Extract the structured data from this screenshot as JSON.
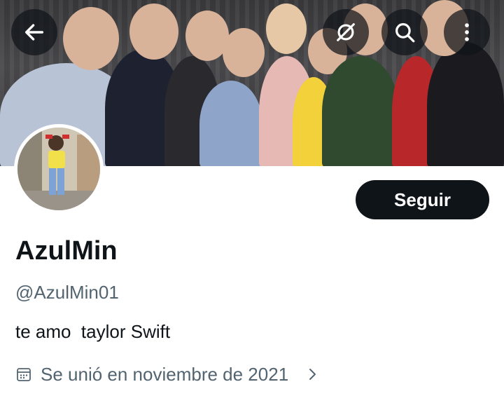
{
  "header": {
    "back_icon": "arrow-left-icon",
    "actions": [
      "sync-off-icon",
      "search-icon",
      "more-vertical-icon"
    ]
  },
  "profile": {
    "display_name": "AzulMin",
    "handle": "@AzulMin01",
    "bio": "te amo  taylor Swift",
    "joined": "Se unió en noviembre de 2021",
    "follow_label": "Seguir"
  },
  "colors": {
    "text_primary": "#0f1419",
    "text_secondary": "#536471",
    "button_bg": "#0f1419",
    "button_text": "#ffffff"
  }
}
